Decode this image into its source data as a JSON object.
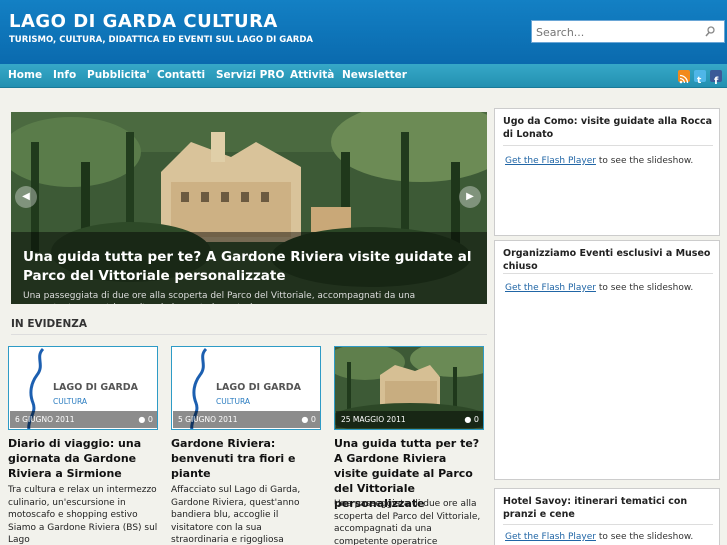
{
  "header": {
    "title": "LAGO DI GARDA CULTURA",
    "tagline": "TURISMO, CULTURA, DIDATTICA ED EVENTI SUL LAGO DI GARDA",
    "search_placeholder": "Search..."
  },
  "nav": {
    "items": [
      "Home",
      "Info",
      "Pubblicita'",
      "Contatti",
      "Servizi PRO",
      "Attività",
      "Newsletter"
    ]
  },
  "colors": {
    "header_blue": "#0f75bc",
    "nav_teal": "#2b9cbf",
    "link_blue": "#2166a6"
  },
  "slider": {
    "title": "Una guida tutta per te? A Gardone Riviera visite guidate al Parco del Vittoriale personalizzate",
    "excerpt": "Una passeggiata di due ore alla scoperta del Parco del Vittoriale, accompagnati da una competente operatrice culturale laureata in materia"
  },
  "featured": {
    "title": "IN EVIDENZA",
    "logo_text_1": "LAGO DI GARDA",
    "logo_text_2": "CULTURA",
    "posts": [
      {
        "date": "6 GIUGNO 2011",
        "comments": "0",
        "title": "Diario di viaggio: una giornata da Gardone Riviera a Sirmione",
        "excerpt": "Tra cultura e relax un intermezzo culinario, un'escursione in motoscafo e shopping estivo Siamo a Gardone Riviera (BS) sul Lago"
      },
      {
        "date": "5 GIUGNO 2011",
        "comments": "0",
        "title": "Gardone Riviera: benvenuti tra fiori e piante",
        "excerpt": "Affacciato sul Lago di Garda, Gardone Riviera, quest'anno bandiera blu, accoglie il visitatore con la sua straordinaria e rigogliosa"
      },
      {
        "date": "25 MAGGIO 2011",
        "comments": "0",
        "title": "Una guida tutta per te? A Gardone Riviera visite guidate al Parco del Vittoriale personalizzate",
        "excerpt": "Una passeggiata di due ore alla scoperta del Parco del Vittoriale, accompagnati da una competente operatrice"
      }
    ]
  },
  "sidebar": {
    "widgets": [
      {
        "title": "Ugo da Como: visite guidate alla Rocca di Lonato",
        "link": "Get the Flash Player",
        "text": " to see the slideshow."
      },
      {
        "title": "Organizziamo Eventi esclusivi a Museo chiuso",
        "link": "Get the Flash Player",
        "text": " to see the slideshow."
      },
      {
        "title": "Hotel Savoy: itinerari tematici con pranzi e cene",
        "link": "Get the Flash Player",
        "text": " to see the slideshow."
      }
    ]
  }
}
